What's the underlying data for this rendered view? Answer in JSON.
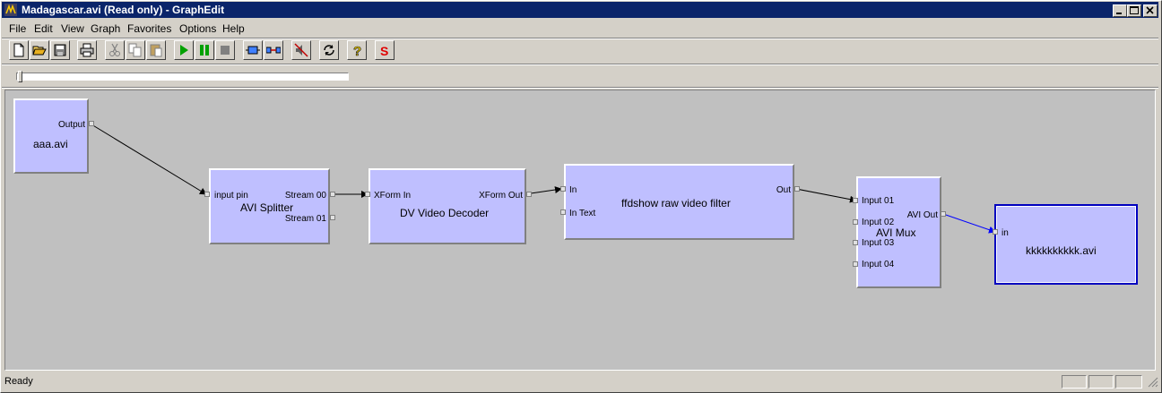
{
  "window": {
    "title": "Madagascar.avi (Read only) - GraphEdit"
  },
  "menu": [
    "File",
    "Edit",
    "View",
    "Graph",
    "Favorites",
    "Options",
    "Help"
  ],
  "toolbar": {
    "buttons": [
      "new-icon",
      "open-icon",
      "save-icon",
      "print-icon",
      "cut-icon",
      "copy-icon",
      "paste-icon",
      "play-icon",
      "pause-icon",
      "stop-icon",
      "filter-icon",
      "connect-icon",
      "mute-icon",
      "refresh-icon",
      "help-icon",
      "s-icon"
    ]
  },
  "seek": {
    "position": 0
  },
  "filters": {
    "source": {
      "name": "aaa.avi",
      "pins": {
        "out": "Output"
      }
    },
    "splitter": {
      "name": "AVI Splitter",
      "pins": {
        "in": "input pin",
        "out0": "Stream 00",
        "out1": "Stream 01"
      }
    },
    "decoder": {
      "name": "DV Video Decoder",
      "pins": {
        "in": "XForm In",
        "out": "XForm Out"
      }
    },
    "ffdshow": {
      "name": "ffdshow raw video filter",
      "pins": {
        "in": "In",
        "in_text": "In Text",
        "out": "Out"
      }
    },
    "mux": {
      "name": "AVI Mux",
      "pins": {
        "in1": "Input 01",
        "in2": "Input 02",
        "in3": "Input 03",
        "in4": "Input 04",
        "out": "AVI Out"
      }
    },
    "writer": {
      "name": "kkkkkkkkkk.avi",
      "pins": {
        "in": "in"
      }
    }
  },
  "status": {
    "text": "Ready"
  },
  "colors": {
    "filter_bg": "#bfbfff",
    "canvas": "#c0c0c0",
    "selected_border": "#0000c0",
    "selected_wire": "#0000ff",
    "wire": "#000000",
    "titlebar": "#0a246a"
  }
}
